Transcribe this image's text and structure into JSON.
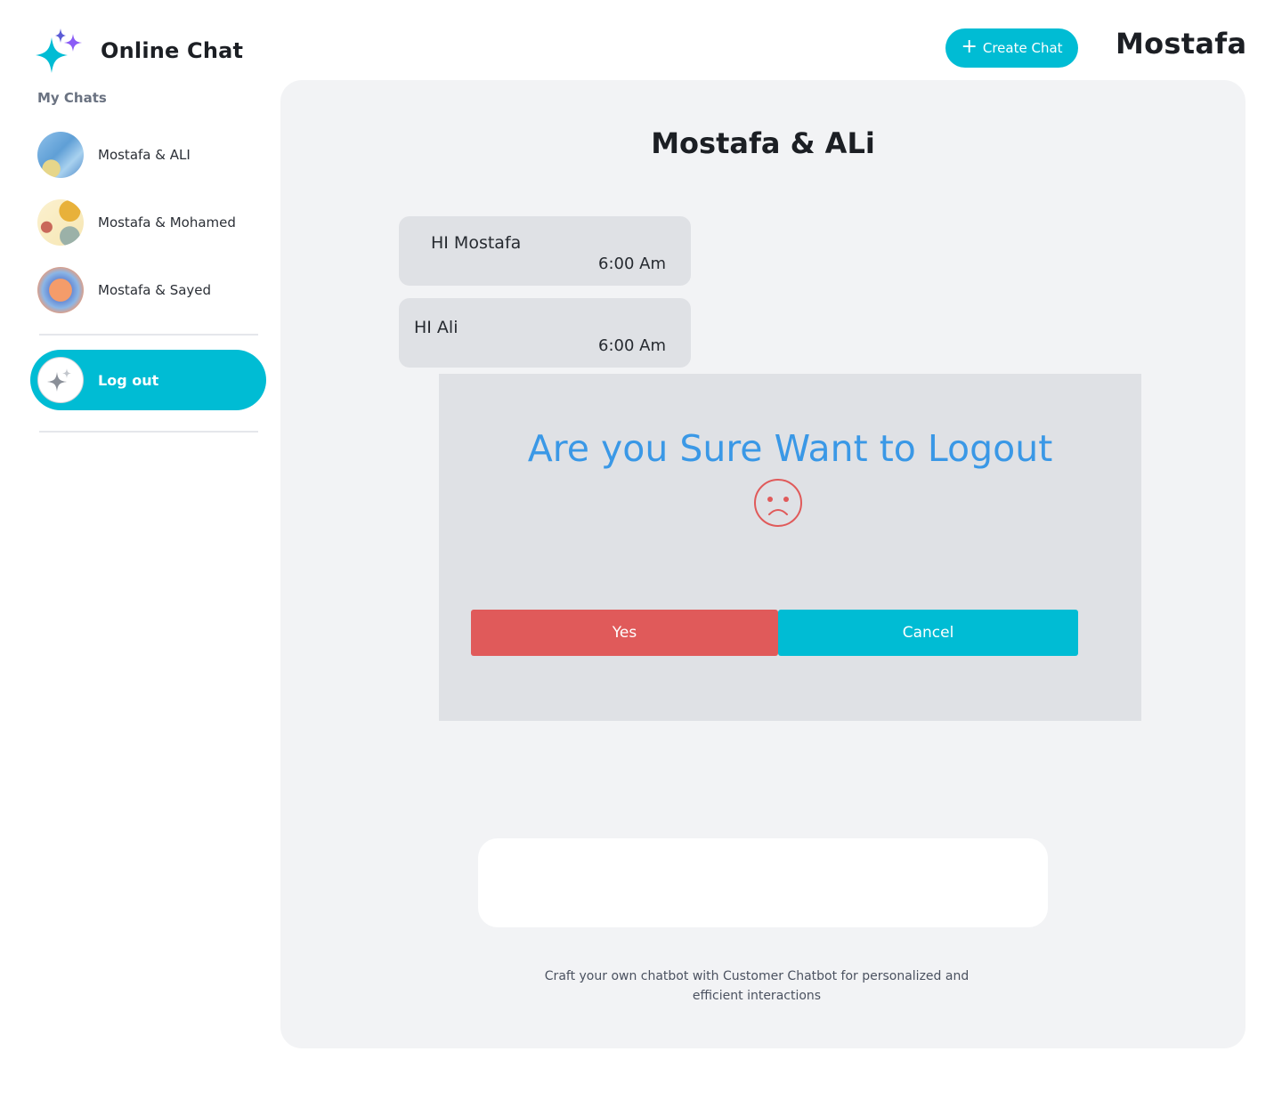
{
  "app": {
    "title": "Online Chat",
    "brand_icon": "sparkles-icon",
    "accent_color": "#00bcd4"
  },
  "header": {
    "create_chat_label": "Create Chat",
    "create_chat_icon": "plus-icon",
    "user_name": "Mostafa"
  },
  "sidebar": {
    "section_label": "My Chats",
    "chats": [
      {
        "label": "Mostafa & ALI"
      },
      {
        "label": "Mostafa & Mohamed"
      },
      {
        "label": "Mostafa & Sayed"
      }
    ],
    "logout_label": "Log out",
    "logout_icon": "sparkles-icon"
  },
  "conversation": {
    "title": "Mostafa & ALi",
    "messages": [
      {
        "text": "HI Mostafa",
        "time": "6:00 Am"
      },
      {
        "text": "HI Ali",
        "time": "6:00 Am"
      }
    ],
    "footer_note": "Craft your own chatbot with Customer Chatbot for personalized and efficient interactions"
  },
  "dialog": {
    "title": "Are you Sure Want to Logout",
    "icon": "sad-face-icon",
    "yes_label": "Yes",
    "cancel_label": "Cancel",
    "yes_color": "#e05a5a",
    "cancel_color": "#00bcd4"
  }
}
